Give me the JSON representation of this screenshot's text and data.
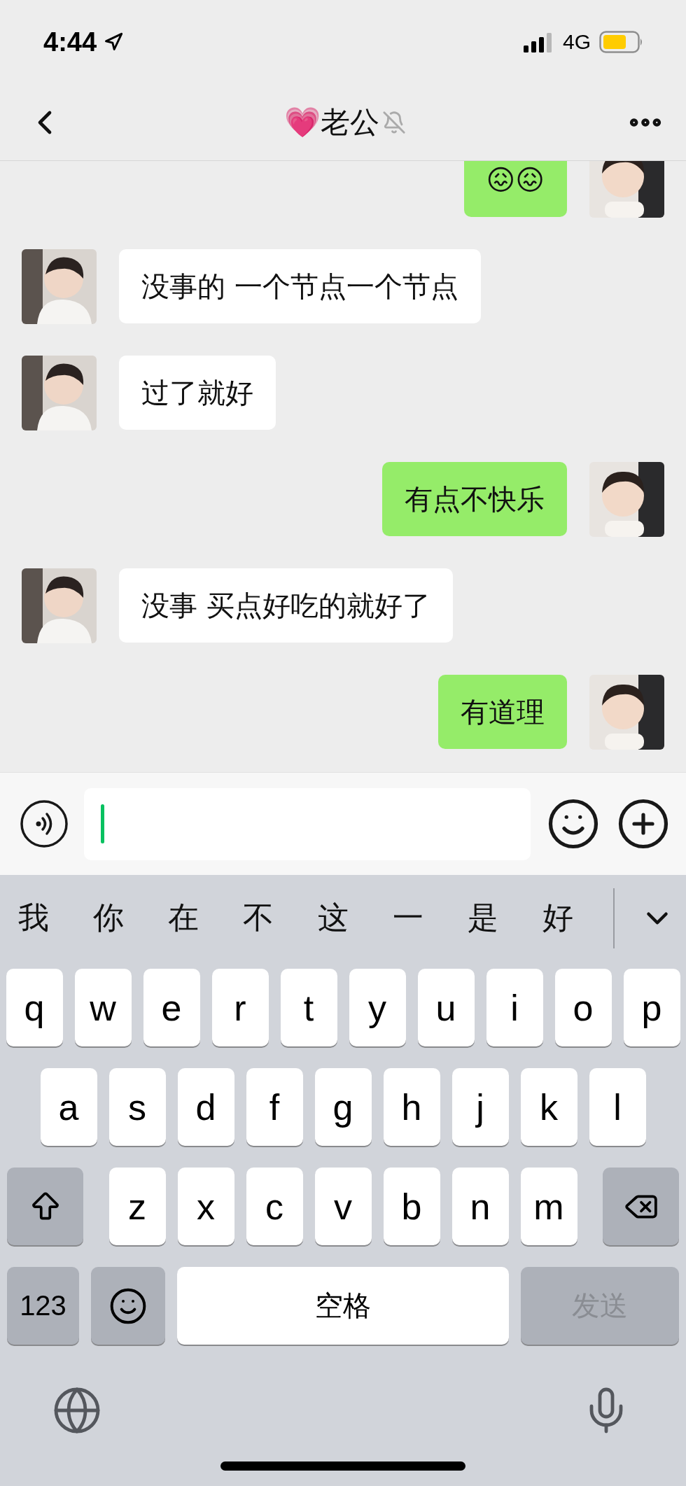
{
  "status_bar": {
    "time": "4:44",
    "network": "4G"
  },
  "nav": {
    "title": "💗老公",
    "muted": true
  },
  "messages": [
    {
      "kind": "sent",
      "text": "😖😖"
    },
    {
      "kind": "received",
      "text": "没事的 一个节点一个节点"
    },
    {
      "kind": "received",
      "text": "过了就好"
    },
    {
      "kind": "sent",
      "text": "有点不快乐"
    },
    {
      "kind": "received",
      "text": "没事 买点好吃的就好了"
    },
    {
      "kind": "sent",
      "text": "有道理"
    }
  ],
  "candidates": [
    "我",
    "你",
    "在",
    "不",
    "这",
    "一",
    "是",
    "好"
  ],
  "keyboard": {
    "rows": [
      [
        "q",
        "w",
        "e",
        "r",
        "t",
        "y",
        "u",
        "i",
        "o",
        "p"
      ],
      [
        "a",
        "s",
        "d",
        "f",
        "g",
        "h",
        "j",
        "k",
        "l"
      ],
      [
        "z",
        "x",
        "c",
        "v",
        "b",
        "n",
        "m"
      ]
    ],
    "number_key": "123",
    "space_key": "空格",
    "send_key": "发送",
    "send_disabled": true
  }
}
